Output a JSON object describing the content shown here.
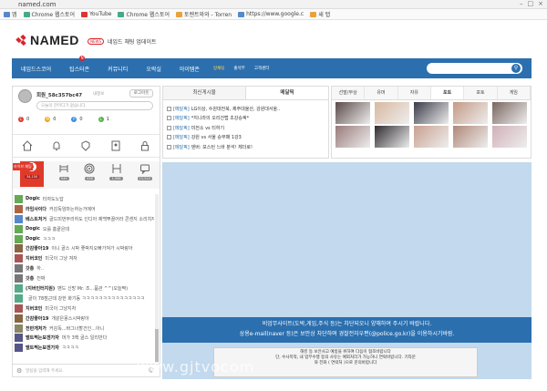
{
  "browser": {
    "url": "named.com",
    "bookmarks": [
      {
        "label": "앱",
        "color": "#58c"
      },
      {
        "label": "Chrome 웹스토어",
        "color": "#4a8"
      },
      {
        "label": "YouTube",
        "color": "#d33"
      },
      {
        "label": "Chrome 웹스토어",
        "color": "#4a8"
      },
      {
        "label": "토렌트와와 - Torren",
        "color": "#e9a23b"
      },
      {
        "label": "https://www.google.c",
        "color": "#58c"
      },
      {
        "label": "새 탭",
        "color": "#e9a23b"
      }
    ]
  },
  "header": {
    "logo": "NAMED",
    "news_badge": "NEWS",
    "news_text": "네임드 채팅 업데이트"
  },
  "nav": {
    "items": [
      "네임드스코어",
      "팁스터존",
      "커뮤니티",
      "오락실",
      "아이템존"
    ],
    "small_items": [
      "방채팅",
      "출석부",
      "고객센터"
    ],
    "new_badge": "N"
  },
  "profile": {
    "username": "회원_58c357bc47",
    "info_link": "내정보",
    "logout": "로그아웃",
    "status_placeholder": "오늘의 한마디가 없습니다.",
    "points": [
      {
        "icon": "C",
        "value": "0",
        "color": "#e0392b"
      },
      {
        "icon": "M",
        "value": "0",
        "color": "#f2a31b"
      },
      {
        "icon": "P",
        "value": "0",
        "color": "#3a8de0"
      },
      {
        "icon": "L",
        "value": "1",
        "color": "#58b34a"
      }
    ]
  },
  "chat_tabs": {
    "live_label": "라이브 채팅",
    "counts": [
      "34,150",
      "949",
      "438",
      "1,596",
      "15,510"
    ]
  },
  "chat": {
    "messages": [
      {
        "nick": "Dogic",
        "text": "타자도노답",
        "color": "#6a5"
      },
      {
        "nick": "라임사이다",
        "text": "커감독임마는하는거에어",
        "color": "#a64"
      },
      {
        "nick": "베스트처거",
        "text": "골드미번부리하도 인디아 제백뿌끌어라 콘센지 소리치자",
        "color": "#58c"
      },
      {
        "nick": "Dogic",
        "text": "오를 홈끝은데",
        "color": "#6a5"
      },
      {
        "nick": "Dogic",
        "text": "ㅋㅋㅋ",
        "color": "#6a5"
      },
      {
        "nick": "간감좋아19",
        "text": "이니 골스 시박 좋박지오빠가져가 시박랑아",
        "color": "#864"
      },
      {
        "nick": "지버코인",
        "text": "미국이 그냥 져자",
        "color": "#a55"
      },
      {
        "nick": "갓총",
        "text": "하..",
        "color": "#777"
      },
      {
        "nick": "갓총",
        "text": "진짜",
        "color": "#777"
      },
      {
        "nick": "(지버인터지원)",
        "text": "밴드 신망 Mr. 조...품관 ^^)오늘짝)",
        "color": "#5a8"
      },
      {
        "nick": "",
        "text": "골이 78점근데 강한 화기동 ㅋㅋㅋㅋㅋㅋㅋㅋㅋㅋㅋㅋㅋㅋㅋ",
        "color": "#5a8"
      },
      {
        "nick": "지버코인",
        "text": "미국이 그냥지자",
        "color": "#a55"
      },
      {
        "nick": "간감좋아19",
        "text": "개같은몽스시박랑아",
        "color": "#864"
      },
      {
        "nick": "전반개처가",
        "text": "커감독...바그너할건인...아니",
        "color": "#886"
      },
      {
        "nick": "벨트찍는보겐가자",
        "text": "머가 3핵 골스 일리반다",
        "color": "#558"
      },
      {
        "nick": "벨트찍는보겐가자",
        "text": "ㅋㅋㅋㅋ",
        "color": "#558"
      }
    ],
    "input_placeholder": "말씀을 입력해 주세요."
  },
  "board": {
    "tabs": [
      "최신게시물",
      "메달픽"
    ],
    "posts": [
      {
        "cat": "[메달픽]",
        "title": "LG이상, 수원대전북, 제주대울산, 강원대서울.."
      },
      {
        "cat": "[메달픽]",
        "title": "*지니라의 오리건랩 초강승픽*"
      },
      {
        "cat": "[메달픽]",
        "title": "미전소 vs 티하기"
      },
      {
        "cat": "[메달픽]",
        "title": "강원 vs 서울 승무패 1강3"
      },
      {
        "cat": "[메달픽]",
        "title": "덴버: 보스턴 느바 분석! 체더로!"
      }
    ]
  },
  "gallery": {
    "tabs": [
      "선발/부상",
      "유머",
      "자유",
      "포토",
      "포토",
      "게임"
    ],
    "active_tab": 3,
    "thumbs": [
      "#5b4a48",
      "#d8b8a0",
      "#3a3a48",
      "#c49a86",
      "#7a6660",
      "#9a7a7a",
      "#2f2a30",
      "#c8a090",
      "#b08878",
      "#d0b0b8"
    ]
  },
  "notice": {
    "line1": "비업무사이트(도박,게임,주식 등)는 차단되오니 양해하여 주시기 바랍니다.",
    "line2": "상용e-mail(naver 등)은 보안상 차단하며 경찰전자우편(@police.go.kr)을 이용하시기바람.",
    "box1": "해킹 등 보안사고 예방을 위하여 다음이 협조바랍니다",
    "box2": "단, 수사목적, 내 업무수행 등의 사유는 예외처리가 가능하니 연락바랍니다. 기타문",
    "box3": "와 전화 ( 연락처 )으로 문의바랍니다"
  },
  "watermark": "www.gjtvocom"
}
